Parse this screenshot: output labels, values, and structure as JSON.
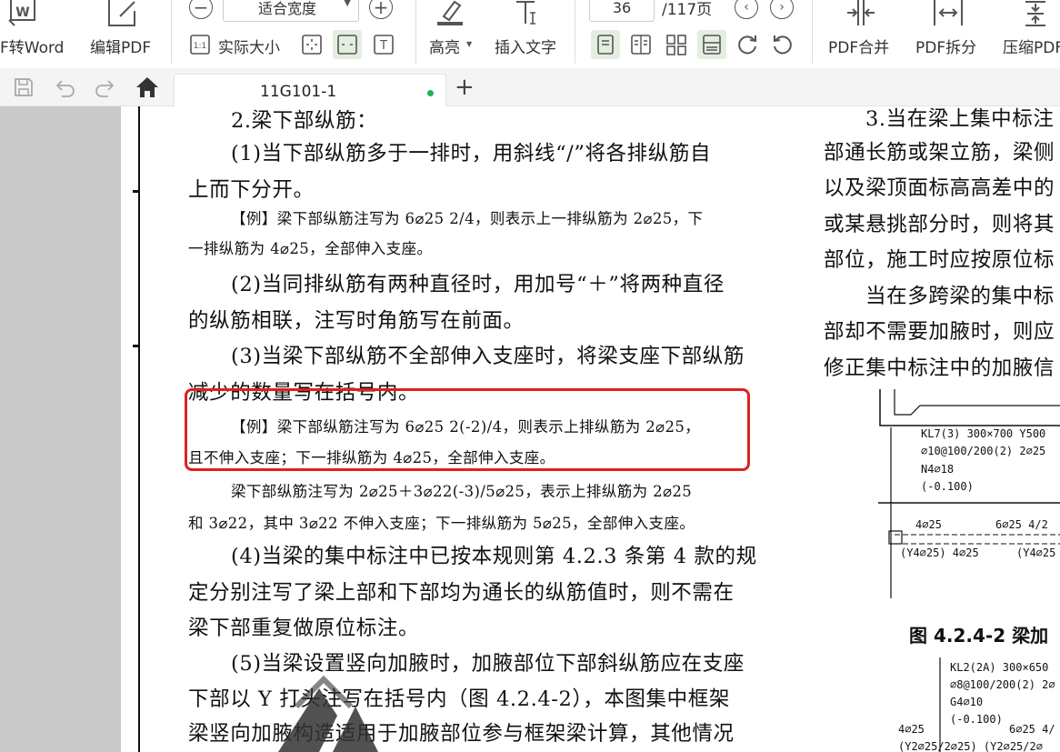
{
  "toolbar": {
    "pdf_to_word": "F转Word",
    "edit_pdf": "编辑PDF",
    "zoom_mode": "适合宽度",
    "actual_size": "实际大小",
    "highlight": "高亮",
    "insert_text": "插入文字",
    "current_page": "36",
    "total_pages": "/117页",
    "pdf_merge": "PDF合并",
    "pdf_split": "PDF拆分",
    "compress_pdf": "压缩PDF"
  },
  "tabs": {
    "active_title": "11G101-1",
    "new_tab_icon": "plus-icon"
  },
  "document": {
    "left_lines": [
      "2.梁下部纵筋：",
      "(1)当下部纵筋多于一排时，用斜线“/”将各排纵筋自",
      "上而下分开。",
      "【例】梁下部纵筋注写为 6⌀25 2/4，则表示上一排纵筋为 2⌀25，下",
      "一排纵筋为 4⌀25，全部伸入支座。",
      "(2)当同排纵筋有两种直径时，用加号“＋”将两种直径",
      "的纵筋相联，注写时角筋写在前面。",
      "(3)当梁下部纵筋不全部伸入支座时，将梁支座下部纵筋",
      "减少的数量写在括号内。",
      "【例】梁下部纵筋注写为 6⌀25 2(-2)/4，则表示上排纵筋为 2⌀25，",
      "且不伸入支座；下一排纵筋为 4⌀25，全部伸入支座。",
      "梁下部纵筋注写为 2⌀25＋3⌀22(-3)/5⌀25，表示上排纵筋为 2⌀25",
      "和 3⌀22，其中 3⌀22 不伸入支座；下一排纵筋为 5⌀25，全部伸入支座。",
      "(4)当梁的集中标注中已按本规则第 4.2.3 条第 4 款的规",
      "定分别注写了梁上部和下部均为通长的纵筋值时，则不需在",
      "梁下部重复做原位标注。",
      "(5)当梁设置竖向加腋时，加腋部位下部斜纵筋应在支座",
      "下部以 Y 打头注写在括号内（图 4.2.4-2），本图集中框架",
      "梁竖向加腋构造适用于加腋部位参与框架梁计算，其他情况"
    ],
    "right_lines": [
      "3.当在梁上集中标注",
      "部通长筋或架立筋，梁侧",
      "以及梁顶面标高高差中的",
      "或某悬挑部分时，则将其",
      "部位，施工时应按原位标",
      "当在多跨梁的集中标",
      "部却不需要加腋时，则应",
      "修正集中标注中的加腋信"
    ],
    "figure_caption": "图 4.2.4-2  梁加",
    "figure1_labels": [
      "KL7(3) 300×700 Y500",
      "⌀10@100/200(2) 2⌀25",
      "N4⌀18",
      "(-0.100)",
      "4⌀25",
      "6⌀25 4/2",
      "(Y4⌀25)  4⌀25",
      "(Y4⌀25"
    ],
    "figure2_labels": [
      "KL2(2A) 300×650",
      "⌀8@100/200(2) 2⌀",
      "G4⌀10",
      "(-0.100)",
      "4⌀25",
      "6⌀25 4/",
      "(Y2⌀25/2⌀25)  (Y2⌀25/2⌀"
    ]
  },
  "colors": {
    "highlight_box": "#e02020",
    "active_tab_dot": "#22b14c",
    "left_panel": "#c9c9c9"
  }
}
